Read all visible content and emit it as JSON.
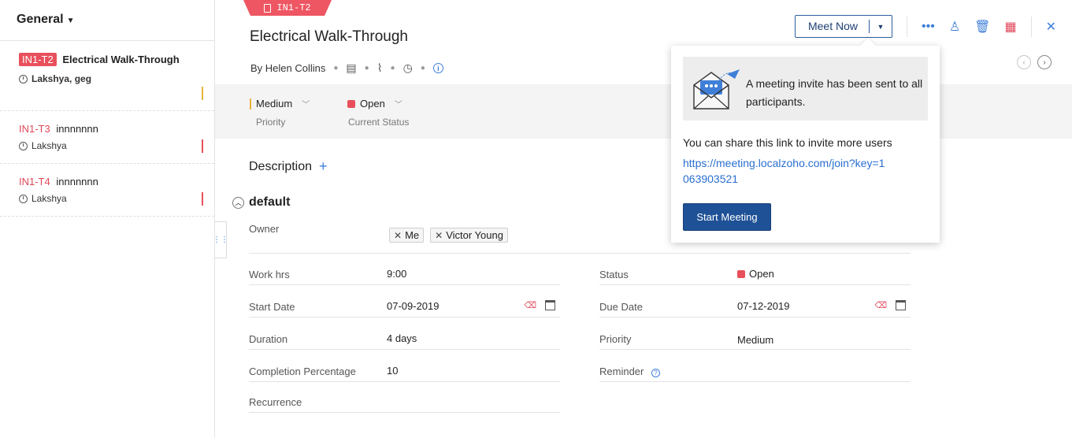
{
  "sidebar": {
    "header": "General",
    "tasks": [
      {
        "id": "IN1-T2",
        "title": "Electrical Walk-Through",
        "assignees": "Lakshya, geg",
        "priority_color": "#e5b63a"
      },
      {
        "id": "IN1-T3",
        "title": "innnnnnn",
        "assignees": "Lakshya",
        "priority_color": "#e8505c"
      },
      {
        "id": "IN1-T4",
        "title": "innnnnnn",
        "assignees": "Lakshya",
        "priority_color": "#e8505c"
      }
    ]
  },
  "task": {
    "ribbon_id": "IN1-T2",
    "title": "Electrical Walk-Through",
    "author": "By Helen Collins",
    "priority": {
      "value": "Medium",
      "label": "Priority"
    },
    "status": {
      "value": "Open",
      "label": "Current Status"
    },
    "description_label": "Description",
    "section_name": "default",
    "owner_label": "Owner",
    "owners": [
      "Me",
      "Victor Young"
    ],
    "fields_left": [
      {
        "label": "Work hrs",
        "value": "9:00"
      },
      {
        "label": "Start Date",
        "value": "07-09-2019"
      },
      {
        "label": "Duration",
        "value": "4 days"
      },
      {
        "label": "Completion Percentage",
        "value": "10"
      },
      {
        "label": "Recurrence",
        "value": ""
      }
    ],
    "fields_right": [
      {
        "label": "Status",
        "value": "Open"
      },
      {
        "label": "Due Date",
        "value": "07-12-2019"
      },
      {
        "label": "Priority",
        "value": "Medium"
      },
      {
        "label": "Reminder",
        "value": ""
      }
    ]
  },
  "toolbar": {
    "meet_label": "Meet Now",
    "icons": [
      "more-icon",
      "user-icon",
      "trash-icon",
      "timesheet-icon",
      "close-icon"
    ]
  },
  "popover": {
    "message": "A meeting invite has been sent to all participants.",
    "share_text": "You can share this link to invite more users",
    "link": "https://meeting.localzoho.com/join?key=1063903521",
    "start_button": "Start Meeting"
  },
  "colors": {
    "accent": "#3f7fd8",
    "brand_dark": "#1f5196",
    "danger": "#e8505c",
    "medium": "#e5b63a"
  }
}
